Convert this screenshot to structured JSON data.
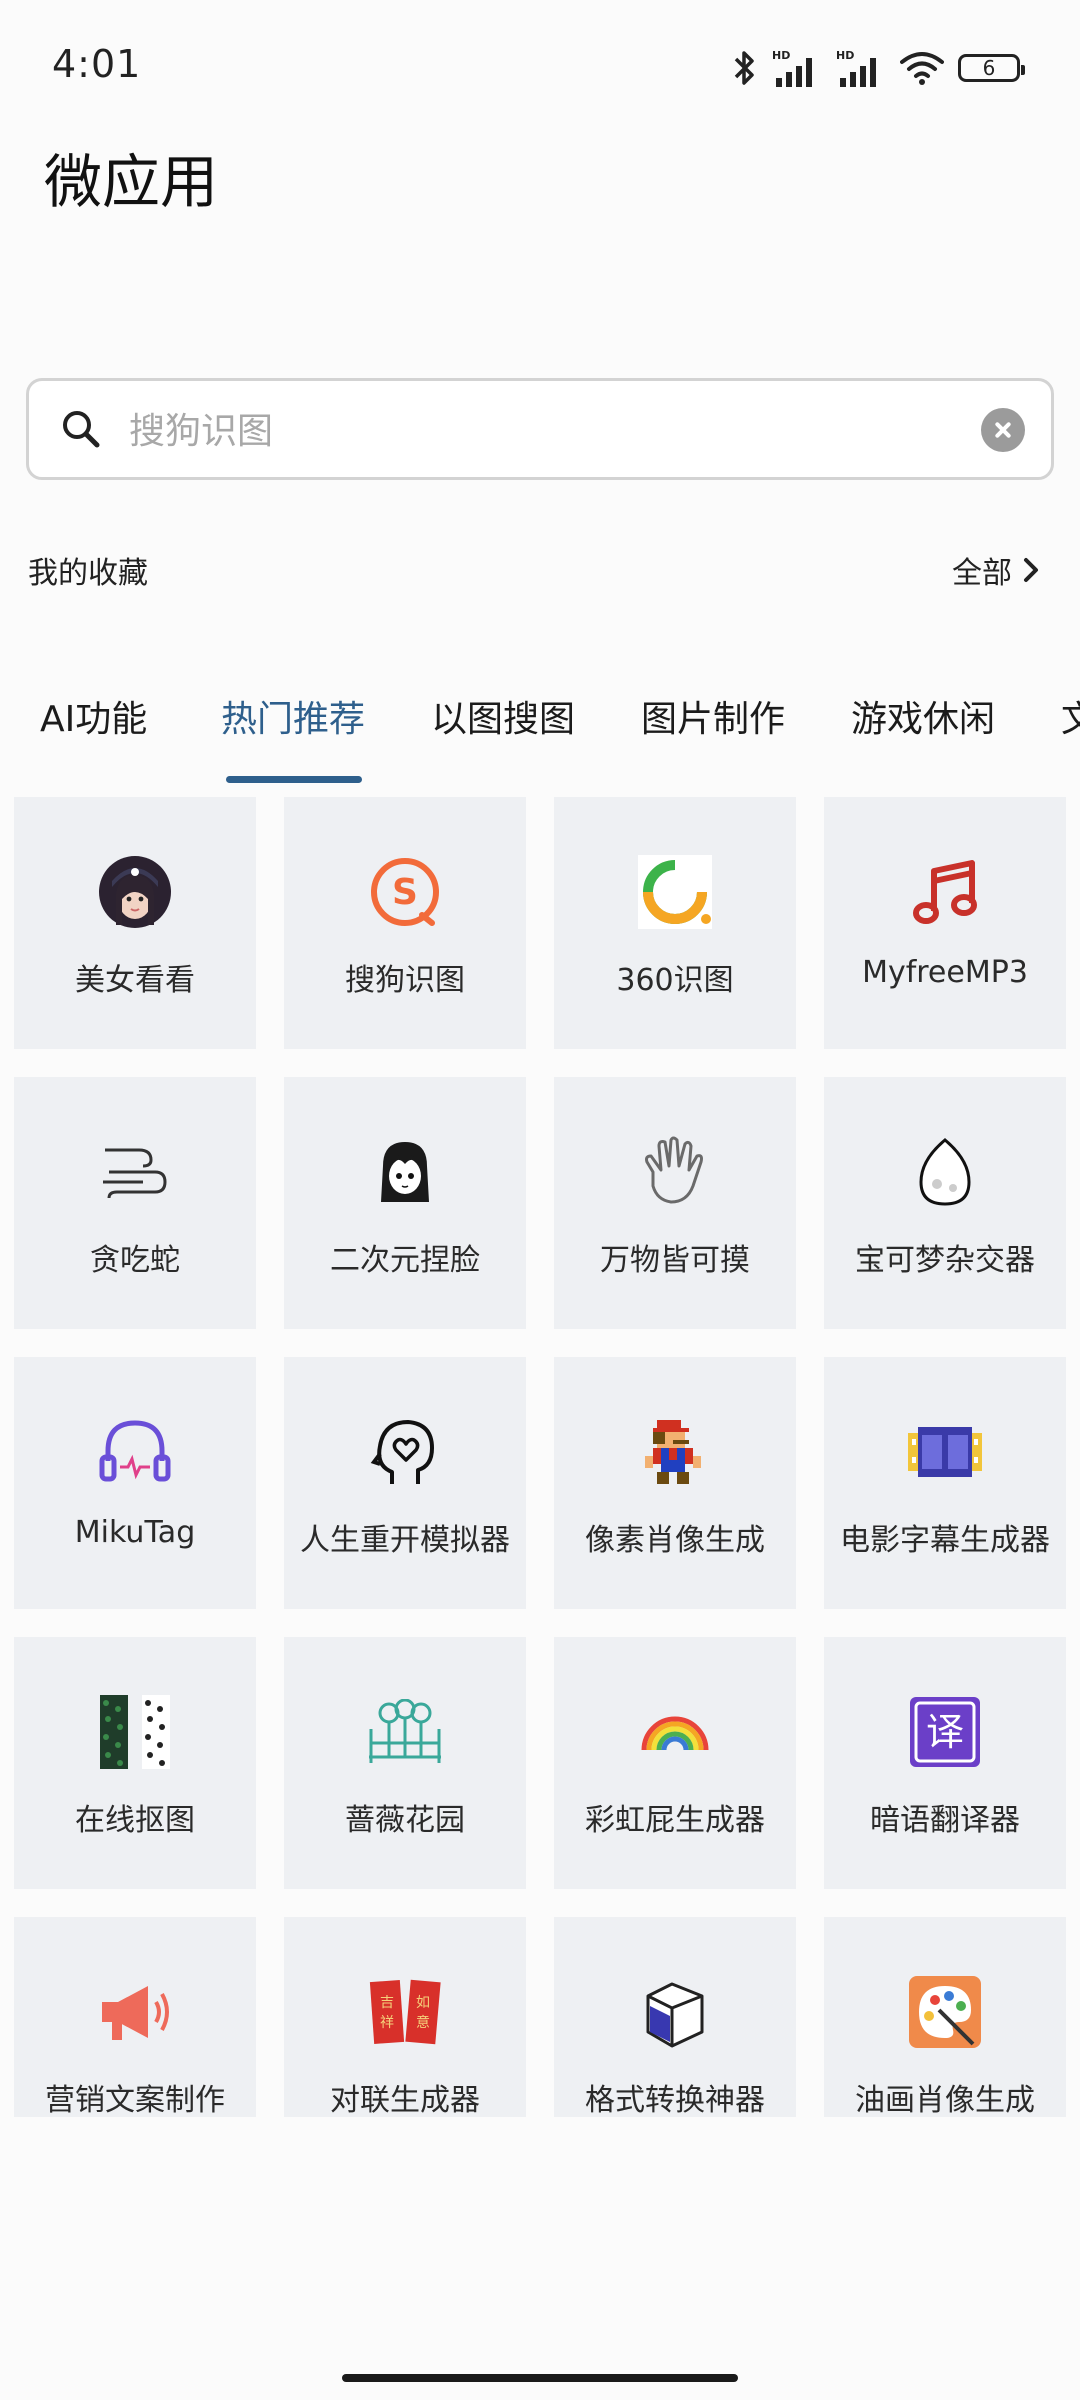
{
  "status_bar": {
    "time": "4:01",
    "battery": "6"
  },
  "page_title": "微应用",
  "search": {
    "placeholder": "搜狗识图",
    "value": ""
  },
  "favorites": {
    "label": "我的收藏",
    "all_label": "全部"
  },
  "tabs": [
    {
      "label": "AI功能",
      "active": false
    },
    {
      "label": "热门推荐",
      "active": true
    },
    {
      "label": "以图搜图",
      "active": false
    },
    {
      "label": "图片制作",
      "active": false
    },
    {
      "label": "游戏休闲",
      "active": false
    },
    {
      "label": "文",
      "active": false
    }
  ],
  "apps": [
    {
      "label": "美女看看",
      "icon": "girl-avatar-icon"
    },
    {
      "label": "搜狗识图",
      "icon": "sogou-icon"
    },
    {
      "label": "360识图",
      "icon": "360-icon"
    },
    {
      "label": "MyfreeMP3",
      "icon": "music-note-icon"
    },
    {
      "label": "贪吃蛇",
      "icon": "snake-icon"
    },
    {
      "label": "二次元捏脸",
      "icon": "anime-face-icon"
    },
    {
      "label": "万物皆可摸",
      "icon": "hand-icon"
    },
    {
      "label": "宝可梦杂交器",
      "icon": "egg-icon"
    },
    {
      "label": "MikuTag",
      "icon": "headphones-icon"
    },
    {
      "label": "人生重开模拟器",
      "icon": "head-heart-icon"
    },
    {
      "label": "像素肖像生成",
      "icon": "pixel-mario-icon"
    },
    {
      "label": "电影字幕生成器",
      "icon": "film-icon"
    },
    {
      "label": "在线抠图",
      "icon": "cutout-icon"
    },
    {
      "label": "蔷薇花园",
      "icon": "garden-icon"
    },
    {
      "label": "彩虹屁生成器",
      "icon": "rainbow-icon"
    },
    {
      "label": "暗语翻译器",
      "icon": "translate-icon"
    },
    {
      "label": "营销文案制作",
      "icon": "megaphone-icon"
    },
    {
      "label": "对联生成器",
      "icon": "couplet-icon"
    },
    {
      "label": "格式转换神器",
      "icon": "cube-convert-icon"
    },
    {
      "label": "油画肖像生成",
      "icon": "palette-icon"
    }
  ],
  "colors": {
    "accent": "#2e5f8c",
    "tile_bg": "#eef0f3"
  }
}
